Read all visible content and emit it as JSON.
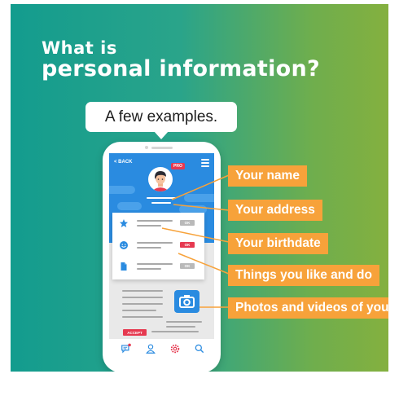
{
  "headline": {
    "line1": "What is",
    "line2": "personal information?"
  },
  "speech_bubble": "A few examples.",
  "phone": {
    "back_label": "< BACK",
    "pro_badge": "PRO",
    "info_tags": [
      "OK",
      "OK",
      "OK"
    ],
    "accept_button": "ACCEPT",
    "tab_icons": [
      "chat-icon",
      "user-icon",
      "settings-icon",
      "search-icon"
    ]
  },
  "labels": [
    "Your name",
    "Your address",
    "Your birthdate",
    "Things you like and do",
    "Photos and videos of you"
  ],
  "colors": {
    "gradient_left": "#139c8e",
    "gradient_right": "#84b03f",
    "label_orange": "#f7a23a",
    "phone_blue": "#2a8be0",
    "accent_red": "#e63950"
  }
}
